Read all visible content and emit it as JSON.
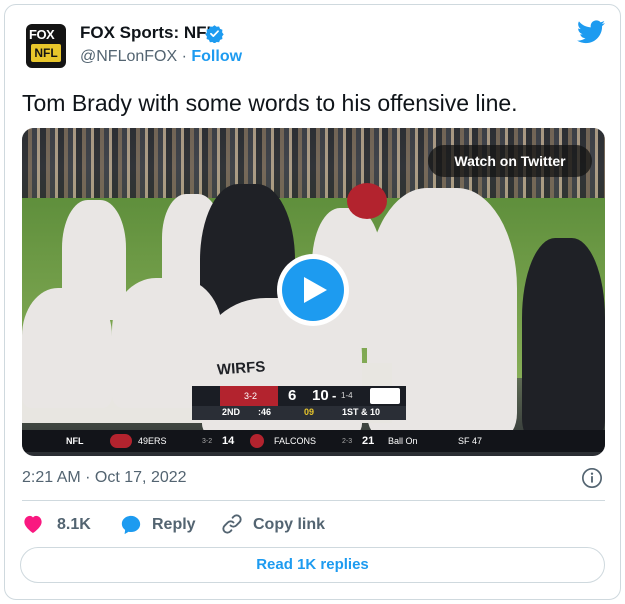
{
  "author": {
    "name": "FOX Sports: NFL",
    "handle": "@NFLonFOX",
    "separator": " · ",
    "follow_label": "Follow",
    "avatar_text_top": "FOX",
    "avatar_text_bottom": "NFL"
  },
  "tweet": {
    "text": "Tom Brady with some words to his offensive line.",
    "timestamp": "2:21 AM · Oct 17, 2022"
  },
  "media": {
    "watch_label": "Watch on Twitter",
    "scorebug": {
      "team1_record": "3-2",
      "team1_score": "6",
      "team2_score": "10",
      "team2_score_suffix": "-",
      "team2_record": "1-4",
      "quarter": "2ND",
      "clock": ":46",
      "play_clock": "09",
      "down_distance": "1ST & 10"
    },
    "ticker": {
      "league": "NFL",
      "team_a": "49ERS",
      "team_a_record": "3-2",
      "team_a_score": "14",
      "team_b": "FALCONS",
      "team_b_record": "2-3",
      "team_b_score": "21",
      "ball_on": "Ball On",
      "ball_position": "SF 47"
    },
    "jersey_name": "WIRFS"
  },
  "actions": {
    "like_count": "8.1K",
    "reply_label": "Reply",
    "copy_link_label": "Copy link",
    "read_replies_label": "Read 1K replies"
  },
  "colors": {
    "accent": "#1d9bf0",
    "like": "#f91880",
    "text": "#0f1419",
    "muted": "#536471",
    "border": "#cfd9de"
  },
  "icons": [
    "verified-badge-icon",
    "twitter-bird-icon",
    "play-icon",
    "info-icon",
    "heart-icon",
    "reply-bubble-icon",
    "link-icon"
  ]
}
